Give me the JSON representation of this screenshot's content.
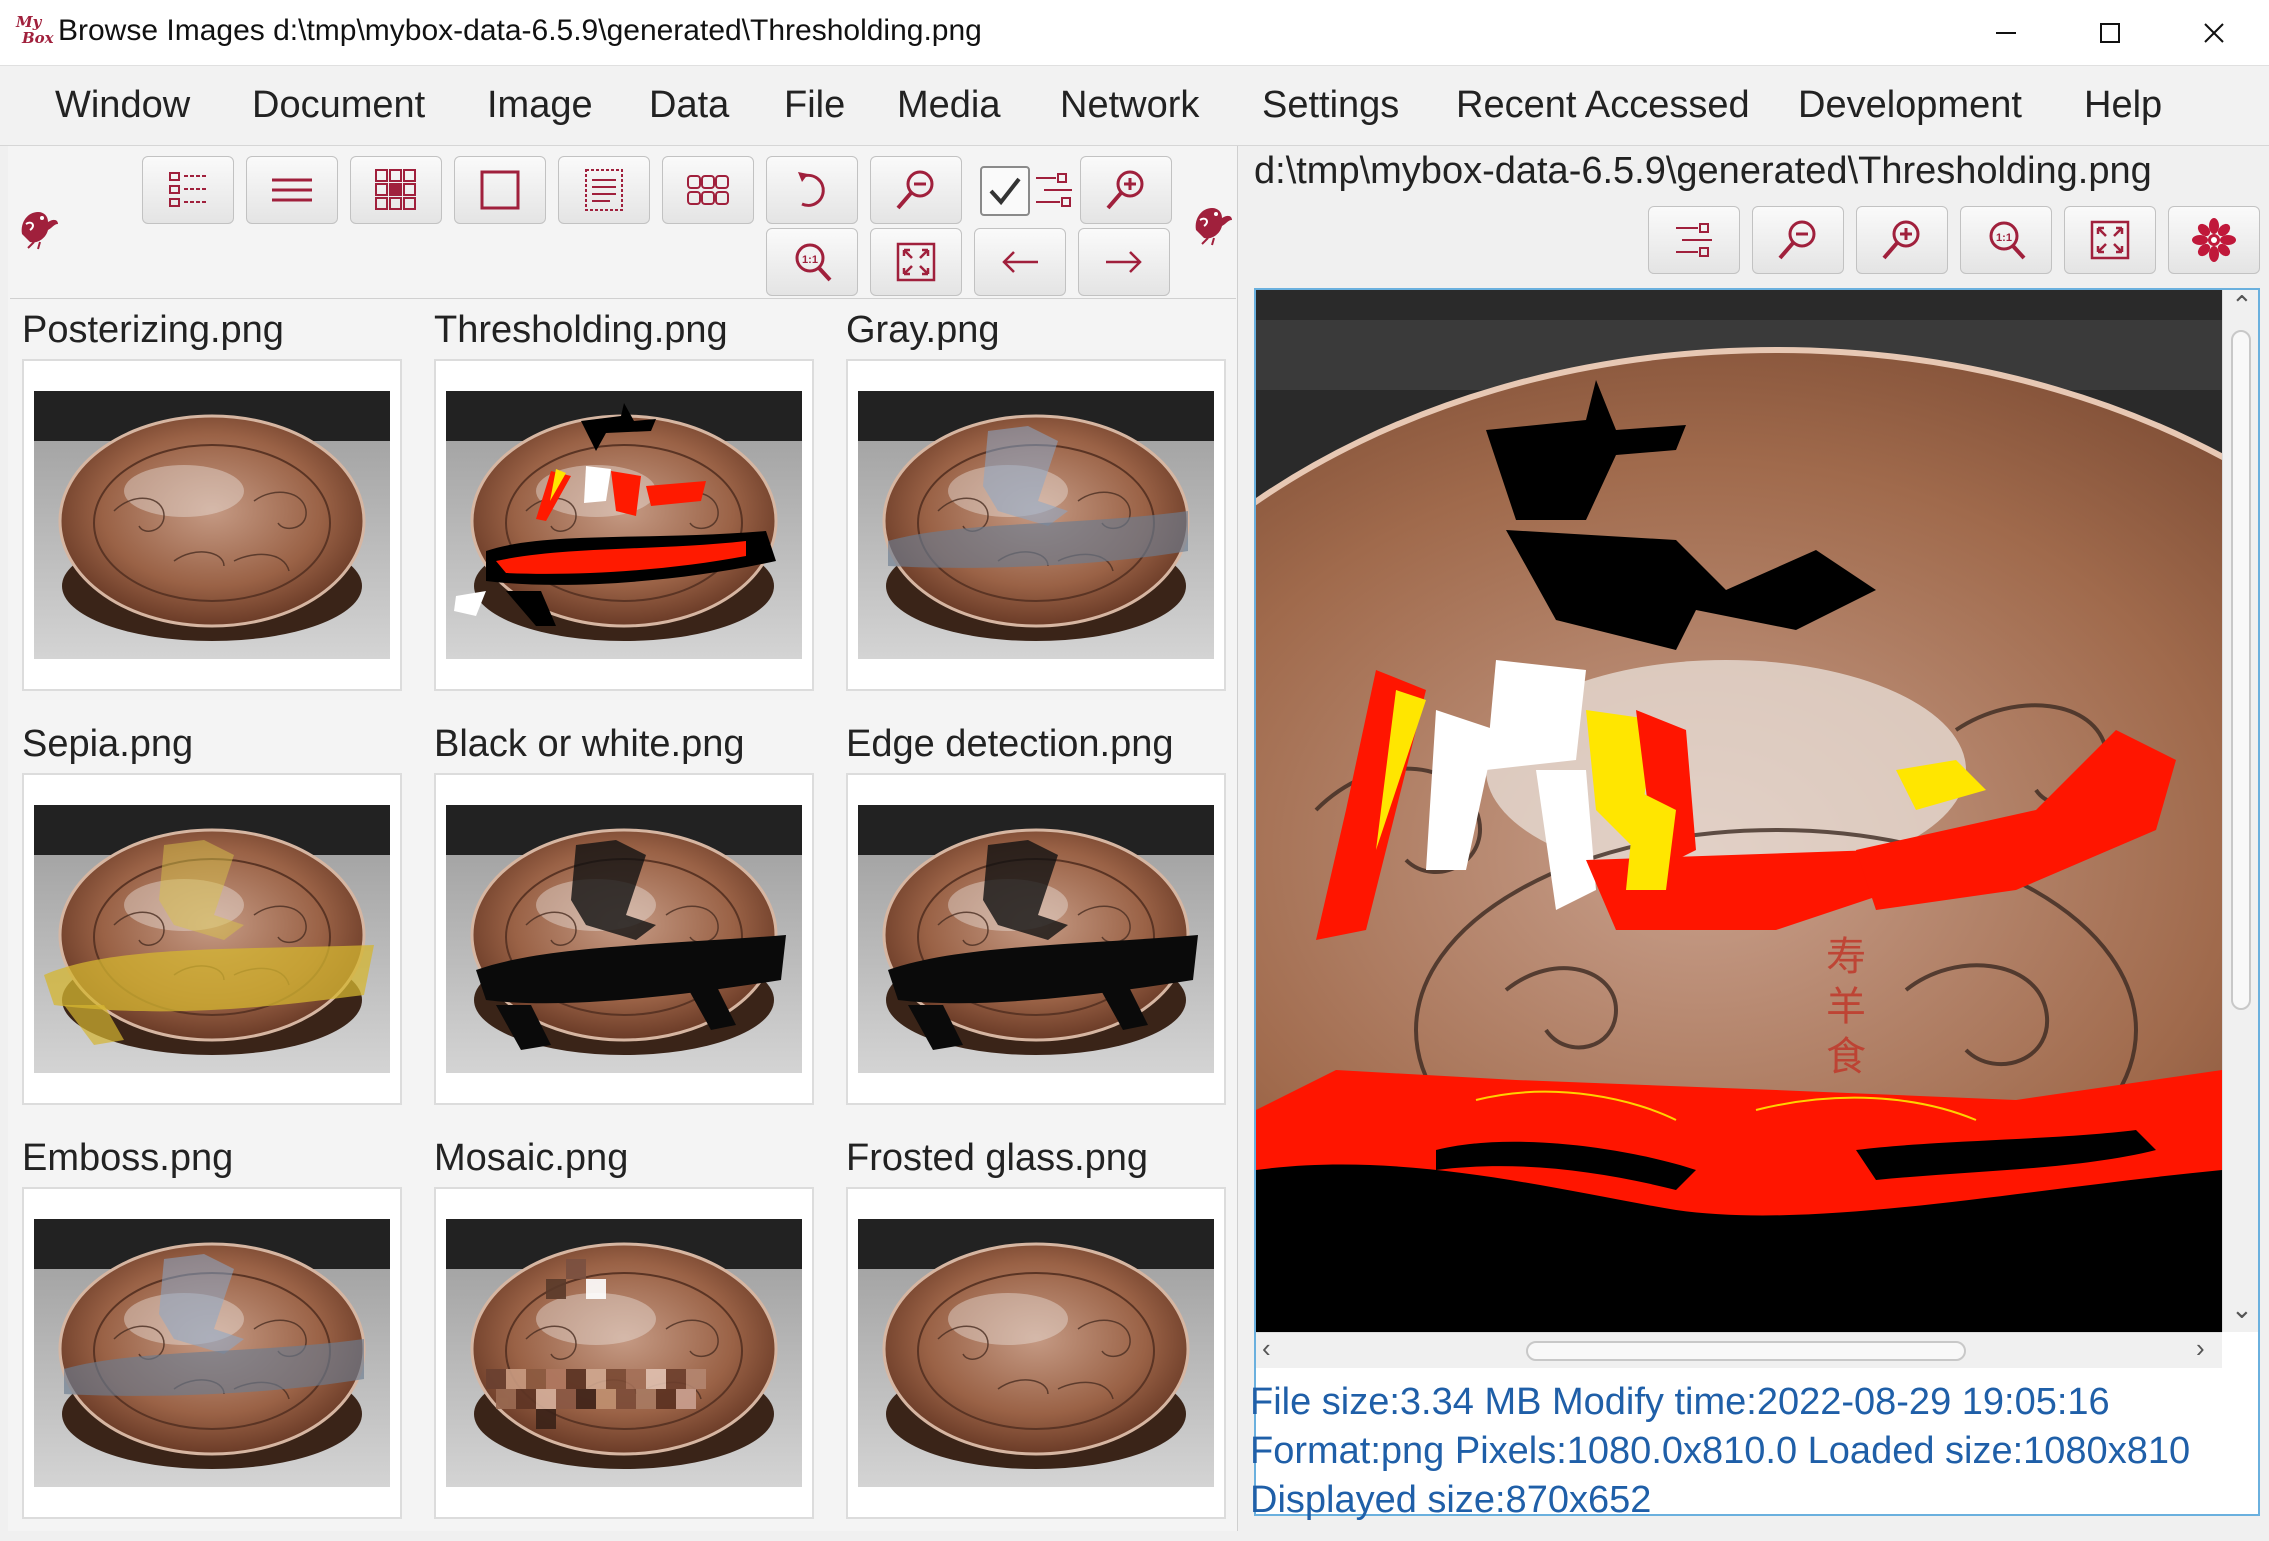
{
  "window": {
    "title": "Browse Images d:\\tmp\\mybox-data-6.5.9\\generated\\Thresholding.png",
    "logo_top": "My",
    "logo_bottom": "Box"
  },
  "menu": [
    "Window",
    "Document",
    "Image",
    "Data",
    "File",
    "Media",
    "Network",
    "Settings",
    "Recent Accessed",
    "Development",
    "Help"
  ],
  "left_toolbar": {
    "buttons": [
      "list-view-icon",
      "rows-icon",
      "thumbnails-grid-icon",
      "single-frame-icon",
      "text-list-icon",
      "cells-icon",
      "rotate-icon",
      "zoom-out-icon",
      "zoom-in-icon",
      "actual-size-icon",
      "fit-icon",
      "previous-arrow-icon",
      "next-arrow-icon"
    ],
    "checkbox_checked": true
  },
  "thumbnails": [
    {
      "name": "Posterizing.png",
      "effect": "none"
    },
    {
      "name": "Thresholding.png",
      "effect": "threshold"
    },
    {
      "name": "Gray.png",
      "effect": "gray"
    },
    {
      "name": "Sepia.png",
      "effect": "sepia"
    },
    {
      "name": "Black or white.png",
      "effect": "bw"
    },
    {
      "name": "Edge detection.png",
      "effect": "edge"
    },
    {
      "name": "Emboss.png",
      "effect": "emboss"
    },
    {
      "name": "Mosaic.png",
      "effect": "mosaic"
    },
    {
      "name": "Frosted glass.png",
      "effect": "frosted"
    }
  ],
  "viewer": {
    "path": "d:\\tmp\\mybox-data-6.5.9\\generated\\Thresholding.png",
    "toolbar": [
      "menu-icon",
      "zoom-out-icon",
      "zoom-in-icon",
      "actual-size-icon",
      "fit-icon",
      "settings-flower-icon"
    ],
    "info_line1": "File size:3.34 MB  Modify time:2022-08-29 19:05:16",
    "info_line2": "Format:png  Pixels:1080.0x810.0  Loaded size:1080x810",
    "info_line3": "Displayed size:870x652"
  },
  "colors": {
    "accent": "#a0203c",
    "info_text": "#1f5fa8",
    "selection_border": "#6ab0de"
  }
}
